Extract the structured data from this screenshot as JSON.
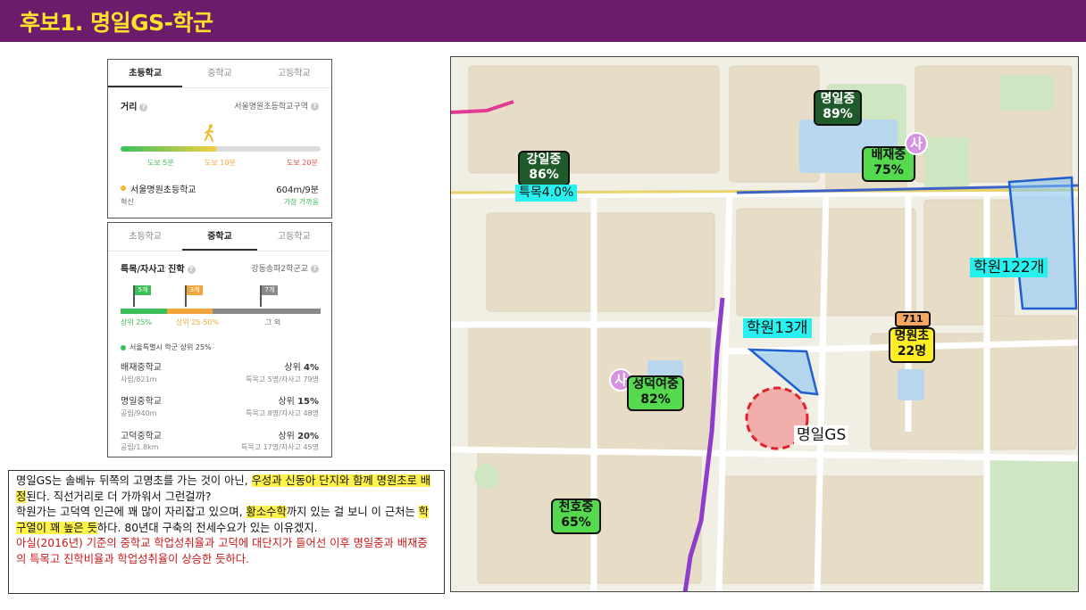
{
  "title": "후보1. 명일GS-학군",
  "elementary_card": {
    "tabs": [
      "초등학교",
      "중학교",
      "고등학교"
    ],
    "active_tab": 0,
    "distance_label": "거리",
    "district": "서울명원초등학교구역",
    "distance_marks": [
      "도보 5분",
      "도보 10분",
      "도보 20분"
    ],
    "mark_colors": [
      "#3cbe5a",
      "#f0a63a",
      "#e44a4a"
    ],
    "progress_fraction": 0.48,
    "school_name": "서울명원초등학교",
    "school_tag": "혁신",
    "distance_value": "604m/9분",
    "nearest_label": "가장 가까움"
  },
  "middle_card": {
    "tabs": [
      "초등학교",
      "중학교",
      "고등학교"
    ],
    "active_tab": 1,
    "advance_label": "특목/자사고 진학",
    "district": "강동송파2학군교",
    "flags": [
      {
        "label": "5개",
        "color": "#3cbe5a"
      },
      {
        "label": "3개",
        "color": "#f0a63a"
      },
      {
        "label": "7개",
        "color": "#8a8a8a"
      }
    ],
    "segments": [
      {
        "label": "상위 25%",
        "color": "#3cbe5a",
        "fraction": 0.23
      },
      {
        "label": "상위 25-50%",
        "color": "#f0a63a",
        "fraction": 0.23
      },
      {
        "label": "그 외",
        "color": "#8a8a8a",
        "fraction": 0.54
      }
    ],
    "legend": "서울특별시 학군 상위 25%",
    "schools": [
      {
        "name": "배재중학교",
        "meta": "사립/821m",
        "rank": "상위",
        "rank_value": "4%",
        "stats": "특목고 5명/자사고 79명"
      },
      {
        "name": "명일중학교",
        "meta": "공립/940m",
        "rank": "상위",
        "rank_value": "15%",
        "stats": "특목고 8명/자사고 48명"
      },
      {
        "name": "고덕중학교",
        "meta": "공립/1.8km",
        "rank": "상위",
        "rank_value": "20%",
        "stats": "특목고 17명/자사고 45명"
      }
    ]
  },
  "text_box": {
    "line1_a": "명일GS는 솔베뉴 뒤쪽의 고명초를 가는 것이 아닌, ",
    "line1_hl": "우성과 신동아 단지와 함께 명원초로 배정",
    "line1_b": "된다. 직선거리로 더 가까워서 그런걸까?",
    "line2_a": "학원가는 고덕역 인근에 꽤 많이 자리잡고 있으며, ",
    "line2_hl1": "황소수학",
    "line2_b": "까지 있는 걸 보니 이 근처는 ",
    "line2_hl2": "학구열이 꽤 높은 듯",
    "line2_c": "하다. 80년대 구축의 전세수요가 있는 이유겠지.",
    "line3_red": "아실(2016년) 기준의 중학교 학업성취율과 고덕에 대단지가 들어선 이후 명일중과 배재중의 특목고 진학비율과 학업성취율이 상승한 듯하다."
  },
  "map": {
    "labels": {
      "myeongil_jung": {
        "name": "명일중",
        "pct": "89%"
      },
      "baejae_jung": {
        "name": "배재중",
        "pct": "75%"
      },
      "gangil_jung": {
        "name": "강일중",
        "pct": "86%"
      },
      "gangil_special": "특목4.0%",
      "academy_122": "학원122개",
      "academy_13": "학원13개",
      "myeongwon_cho": {
        "name": "명원초",
        "count": "22명"
      },
      "seven_eleven": "711",
      "sungdeok": {
        "name": "성덕여중",
        "pct": "82%"
      },
      "myeongil_gs": "명일GS",
      "cheonho_jung": {
        "name": "천호중",
        "pct": "65%"
      },
      "sa_badge": "사"
    },
    "colors": {
      "dark_label": "#1f5a2a",
      "green_label": "#55d94e",
      "cyan_label": "#27f1ef",
      "yellow_label": "#ffee25",
      "academy_zone": "#7fc3f2",
      "gs_circle": "#f07a7a"
    }
  }
}
